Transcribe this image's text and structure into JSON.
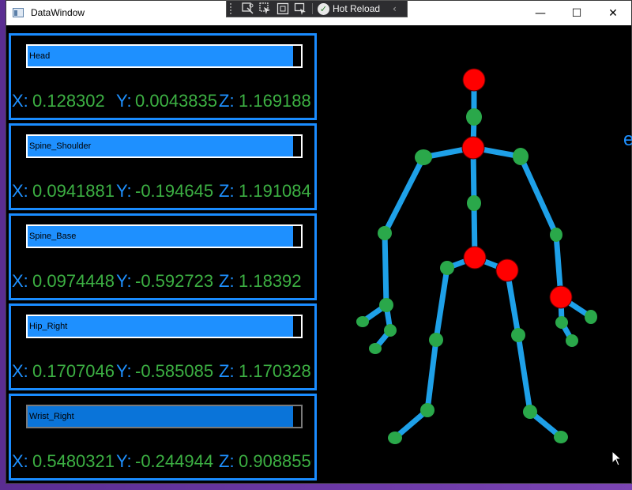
{
  "window": {
    "title": "DataWindow",
    "min": "—",
    "max": "☐",
    "close": "✕"
  },
  "debug_toolbar": {
    "hot_reload_label": "Hot Reload",
    "collapse": "‹"
  },
  "joints_panel": [
    {
      "name": "Head",
      "fill": 0.97,
      "x_label": "X:",
      "x": "0.128302",
      "y_label": "Y:",
      "y": "0.0043835",
      "z_label": "Z:",
      "z": "1.169188"
    },
    {
      "name": "Spine_Shoulder",
      "fill": 0.97,
      "x_label": "X:",
      "x": "0.0941881",
      "y_label": "Y:",
      "y": "-0.194645",
      "z_label": "Z:",
      "z": "1.191084"
    },
    {
      "name": "Spine_Base",
      "fill": 0.97,
      "x_label": "X:",
      "x": "0.0974448",
      "y_label": "Y:",
      "y": "-0.592723",
      "z_label": "Z:",
      "z": "1.18392"
    },
    {
      "name": "Hip_Right",
      "fill": 0.97,
      "x_label": "X:",
      "x": "0.1707046",
      "y_label": "Y:",
      "y": "-0.585085",
      "z_label": "Z:",
      "z": "1.170328"
    },
    {
      "name": "Wrist_Right",
      "fill": 0.97,
      "x_label": "X:",
      "x": "0.5480321",
      "y_label": "Y:",
      "y": "-0.244944",
      "z_label": "Z:",
      "z": "0.9088556"
    }
  ],
  "side_letter": "e",
  "colors": {
    "accent": "#1e90ff",
    "value": "#3cb043",
    "bone": "#1ea0e8",
    "joint": "#2aa84a",
    "tracked_joint": "#ff0000"
  }
}
